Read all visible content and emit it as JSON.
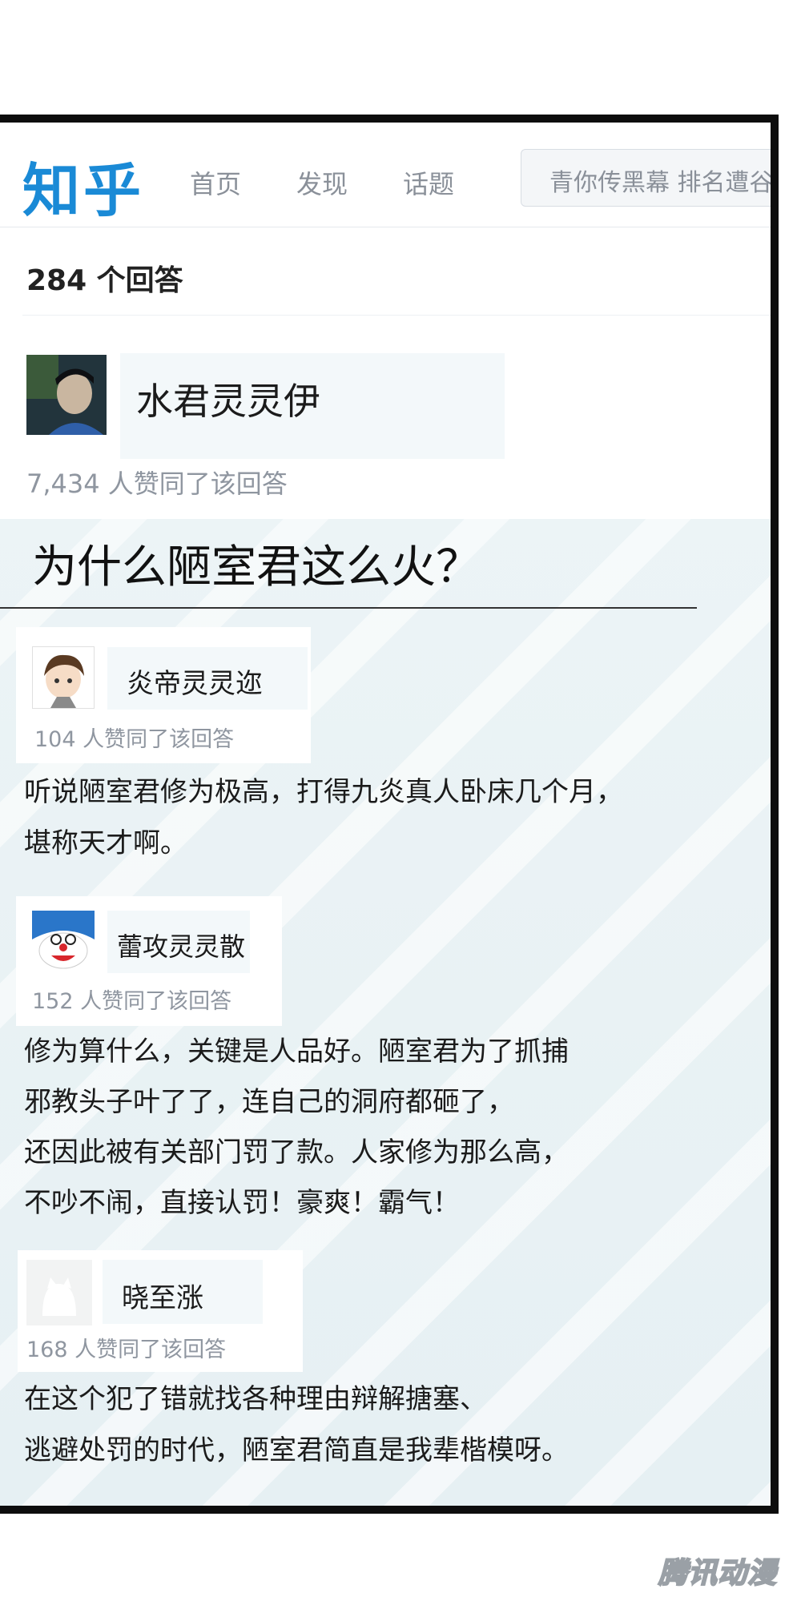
{
  "header": {
    "logo": "知乎",
    "nav": [
      "首页",
      "发现",
      "话题"
    ],
    "search_text": "青你传黑幕 排名遭谷"
  },
  "answers_header": {
    "count_label": "284 个回答"
  },
  "top_answer": {
    "author": "水君灵灵伊",
    "votes": "7,434 人赞同了该回答"
  },
  "question": "为什么陋室君这么火？",
  "comments": [
    {
      "author": "炎帝灵灵迩",
      "votes": "104 人赞同了该回答",
      "lines": [
        "听说陋室君修为极高，打得九炎真人卧床几个月，",
        "堪称天才啊。"
      ]
    },
    {
      "author": "蕾攻灵灵散",
      "votes": "152 人赞同了该回答",
      "lines": [
        "修为算什么，关键是人品好。陋室君为了抓捕",
        "邪教头子叶了了，连自己的洞府都砸了，",
        "还因此被有关部门罚了款。人家修为那么高，",
        "不吵不闹，直接认罚！豪爽！霸气！"
      ]
    },
    {
      "author": "晓至涨",
      "votes": "168 人赞同了该回答",
      "lines": [
        "在这个犯了错就找各种理由辩解搪塞、",
        "逃避处罚的时代，陋室君简直是我辈楷模呀。"
      ]
    }
  ],
  "watermark": "腾讯动漫",
  "icons": {
    "avatar_1": "photo-avatar-icon",
    "avatar_2": "cartoon-boy-avatar-icon",
    "avatar_3": "doraemon-avatar-icon",
    "avatar_4": "cat-avatar-icon"
  },
  "colors": {
    "brand": "#1a8ad6",
    "muted": "#8f96a0"
  }
}
